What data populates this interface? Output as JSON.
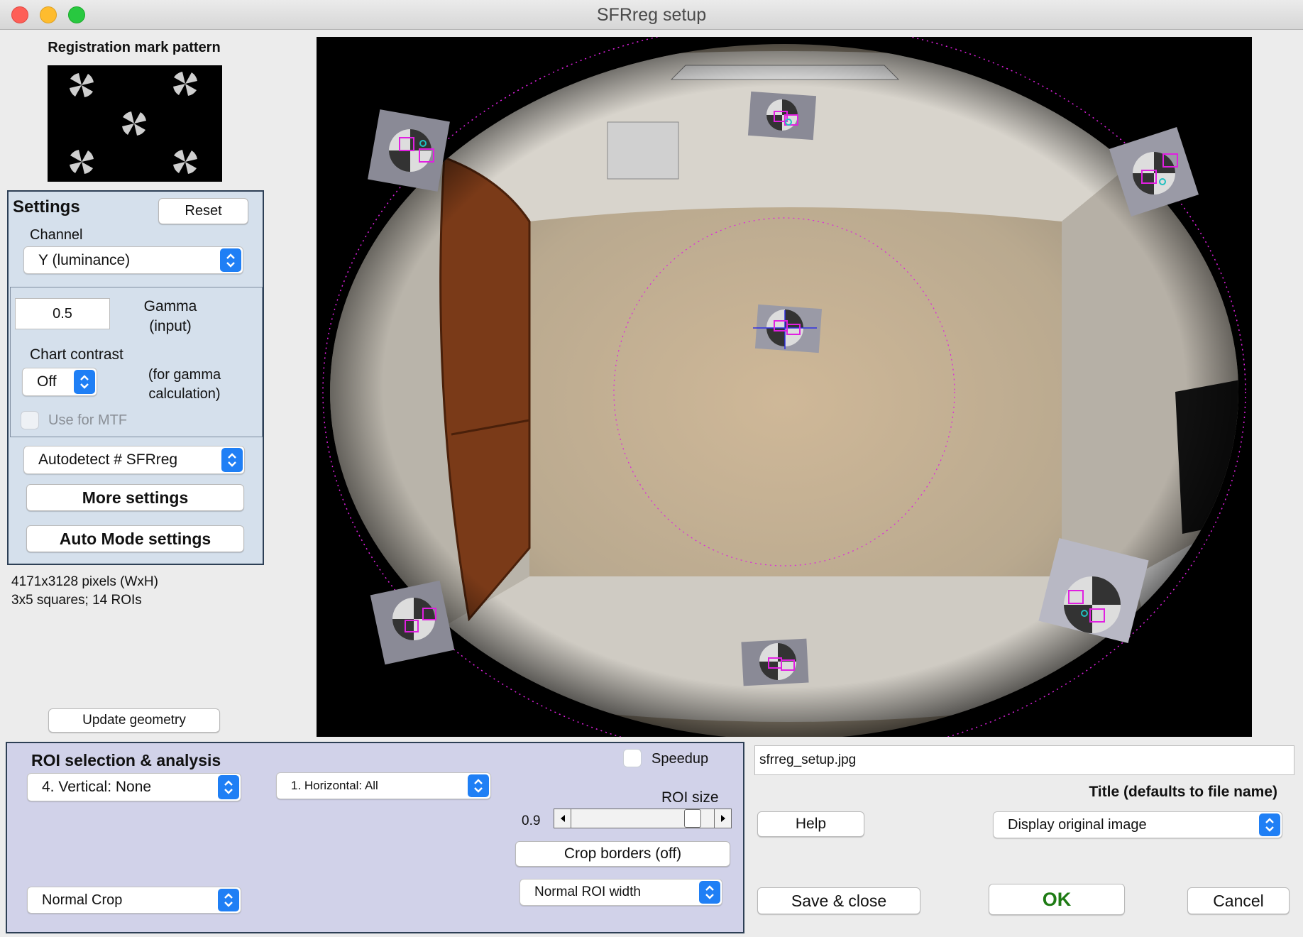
{
  "window": {
    "title": "SFRreg setup"
  },
  "left": {
    "pattern_label": "Registration mark pattern",
    "settings": {
      "heading": "Settings",
      "reset_label": "Reset",
      "channel_label": "Channel",
      "channel_value": "Y (luminance)",
      "gamma_value": "0.5",
      "gamma_label_1": "Gamma",
      "gamma_label_2": "(input)",
      "chart_contrast_label": "Chart contrast",
      "chart_contrast_value": "Off",
      "gamma_calc_1": "(for gamma",
      "gamma_calc_2": "calculation)",
      "use_for_mtf_label": "Use for MTF",
      "autodetect_value": "Autodetect # SFRreg",
      "more_settings_label": "More settings",
      "auto_mode_label": "Auto Mode settings"
    },
    "info_line_1": "4171x3128 pixels (WxH)",
    "info_line_2": "3x5 squares; 14 ROIs",
    "update_geometry_label": "Update geometry"
  },
  "roi": {
    "heading": "ROI selection & analysis",
    "vertical_value": "4.  Vertical: None",
    "horizontal_value": "1.  Horizontal: All",
    "speedup_label": "Speedup",
    "roi_size_label": "ROI size",
    "roi_size_value": "0.9",
    "roi_size_fraction": 0.9,
    "crop_borders_label": "Crop borders  (off)",
    "normal_crop_value": "Normal Crop",
    "roi_width_value": "Normal ROI width"
  },
  "right": {
    "filename": "sfrreg_setup.jpg",
    "title_label": "Title (defaults to file name)",
    "help_label": "Help",
    "display_value": "Display original image",
    "save_close_label": "Save & close",
    "ok_label": "OK",
    "cancel_label": "Cancel"
  },
  "colors": {
    "settings_panel": "#d5e0ec",
    "roi_panel": "#d1d2e9",
    "accent_blue": "#1f7ff5",
    "ok_green": "#1e7b14",
    "roi_marker": "#e020e0",
    "roi_marker_alt": "#20c0c0"
  }
}
